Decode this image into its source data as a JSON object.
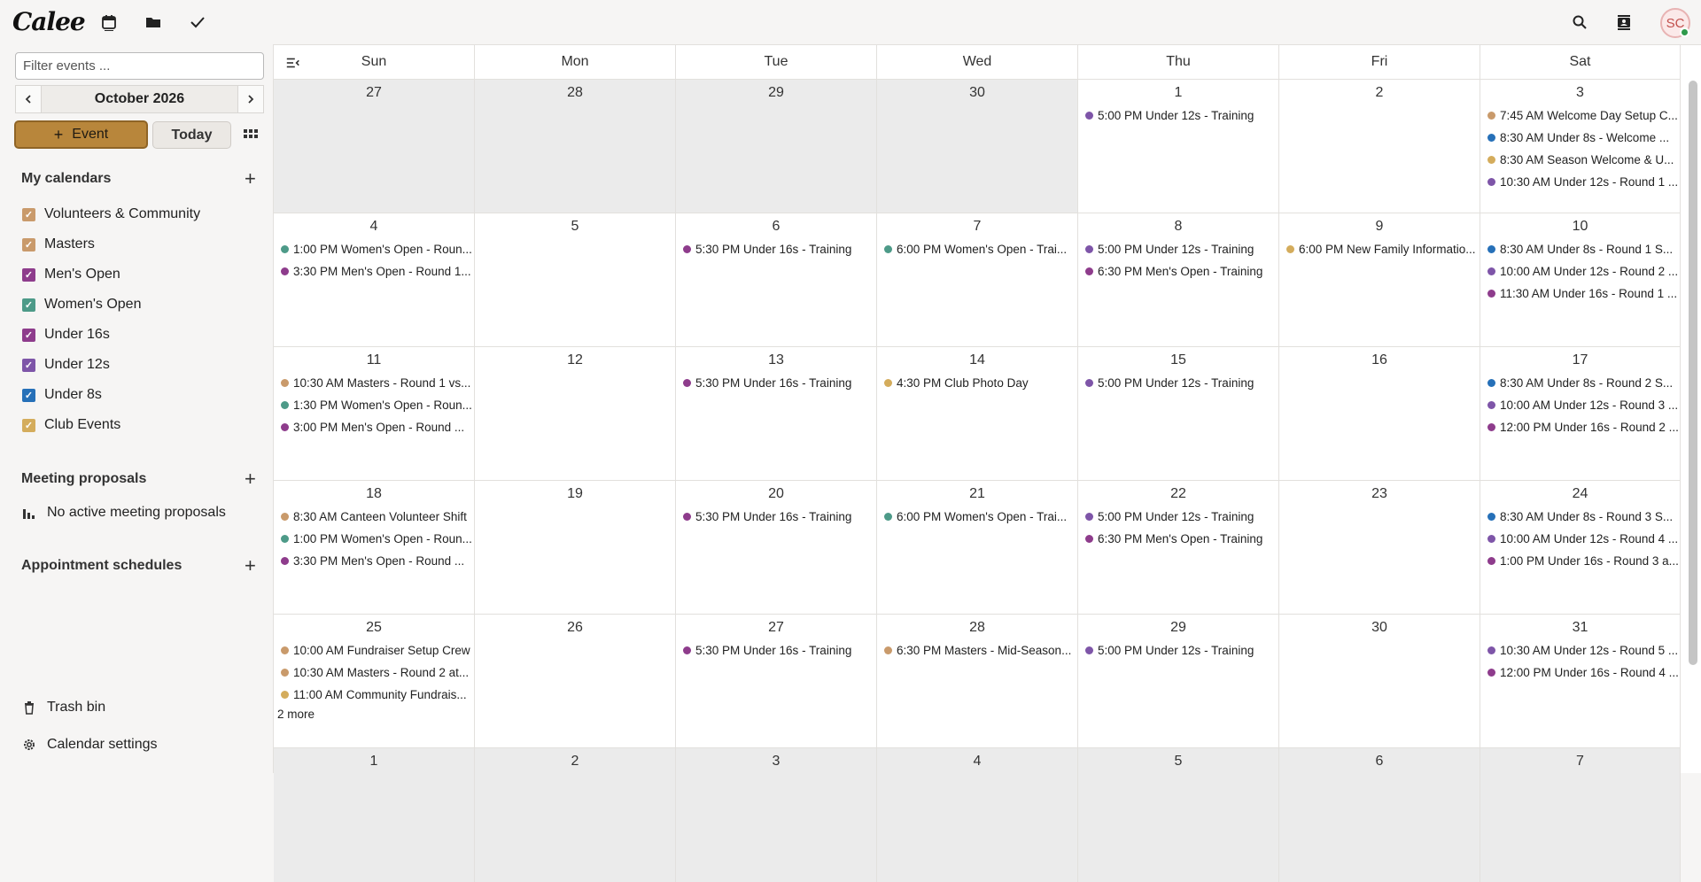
{
  "app": {
    "logo": "Calee"
  },
  "topbar": {
    "icons": [
      "calendar-icon",
      "folder-icon",
      "check-icon",
      "search-icon",
      "contacts-icon"
    ],
    "avatar_initials": "SC"
  },
  "sidebar": {
    "filter_placeholder": "Filter events ...",
    "month_label": "October 2026",
    "prev_label": "‹",
    "next_label": "›",
    "event_button": "Event",
    "today_button": "Today",
    "my_calendars_title": "My calendars",
    "calendars": [
      {
        "label": "Volunteers & Community",
        "color": "#c99a6b"
      },
      {
        "label": "Masters",
        "color": "#c99a6b"
      },
      {
        "label": "Men's Open",
        "color": "#8e3c8c"
      },
      {
        "label": "Women's Open",
        "color": "#4d9a88"
      },
      {
        "label": "Under 16s",
        "color": "#8e3c8c"
      },
      {
        "label": "Under 12s",
        "color": "#7e55a8"
      },
      {
        "label": "Under 8s",
        "color": "#2670b8"
      },
      {
        "label": "Club Events",
        "color": "#d4ac5c"
      }
    ],
    "meeting_title": "Meeting proposals",
    "meeting_empty": "No active meeting proposals",
    "appointment_title": "Appointment schedules",
    "trash_label": "Trash bin",
    "settings_label": "Calendar settings"
  },
  "calendar": {
    "weekdays": [
      "Sun",
      "Mon",
      "Tue",
      "Wed",
      "Thu",
      "Fri",
      "Sat"
    ],
    "colors": {
      "volunteer": "#c99a6b",
      "masters": "#c99a6b",
      "mens": "#8e3c8c",
      "womens": "#4d9a88",
      "u16": "#8e3c8c",
      "u12": "#7e55a8",
      "u8": "#2670b8",
      "club": "#d4ac5c"
    },
    "weeks": [
      [
        {
          "num": "27",
          "out": true,
          "events": []
        },
        {
          "num": "28",
          "out": true,
          "events": []
        },
        {
          "num": "29",
          "out": true,
          "events": []
        },
        {
          "num": "30",
          "out": true,
          "events": []
        },
        {
          "num": "1",
          "events": [
            {
              "text": "5:00 PM Under 12s - Training",
              "cal": "u12"
            }
          ]
        },
        {
          "num": "2",
          "events": []
        },
        {
          "num": "3",
          "events": [
            {
              "text": "7:45 AM Welcome Day Setup C...",
              "cal": "volunteer"
            },
            {
              "text": "8:30 AM Under 8s - Welcome ...",
              "cal": "u8"
            },
            {
              "text": "8:30 AM Season Welcome & U...",
              "cal": "club"
            },
            {
              "text": "10:30 AM Under 12s - Round 1 ...",
              "cal": "u12"
            }
          ]
        }
      ],
      [
        {
          "num": "4",
          "events": [
            {
              "text": "1:00 PM Women's Open - Roun...",
              "cal": "womens"
            },
            {
              "text": "3:30 PM Men's Open - Round 1...",
              "cal": "mens"
            }
          ]
        },
        {
          "num": "5",
          "events": []
        },
        {
          "num": "6",
          "events": [
            {
              "text": "5:30 PM Under 16s - Training",
              "cal": "u16"
            }
          ]
        },
        {
          "num": "7",
          "events": [
            {
              "text": "6:00 PM Women's Open - Trai...",
              "cal": "womens"
            }
          ]
        },
        {
          "num": "8",
          "events": [
            {
              "text": "5:00 PM Under 12s - Training",
              "cal": "u12"
            },
            {
              "text": "6:30 PM Men's Open - Training",
              "cal": "mens"
            }
          ]
        },
        {
          "num": "9",
          "events": [
            {
              "text": "6:00 PM New Family Informatio...",
              "cal": "club"
            }
          ]
        },
        {
          "num": "10",
          "events": [
            {
              "text": "8:30 AM Under 8s - Round 1 S...",
              "cal": "u8"
            },
            {
              "text": "10:00 AM Under 12s - Round 2 ...",
              "cal": "u12"
            },
            {
              "text": "11:30 AM Under 16s - Round 1 ...",
              "cal": "u16"
            }
          ]
        }
      ],
      [
        {
          "num": "11",
          "events": [
            {
              "text": "10:30 AM Masters - Round 1 vs...",
              "cal": "masters"
            },
            {
              "text": "1:30 PM Women's Open - Roun...",
              "cal": "womens"
            },
            {
              "text": "3:00 PM Men's Open - Round ...",
              "cal": "mens"
            }
          ]
        },
        {
          "num": "12",
          "events": []
        },
        {
          "num": "13",
          "events": [
            {
              "text": "5:30 PM Under 16s - Training",
              "cal": "u16"
            }
          ]
        },
        {
          "num": "14",
          "events": [
            {
              "text": "4:30 PM Club Photo Day",
              "cal": "club"
            }
          ]
        },
        {
          "num": "15",
          "events": [
            {
              "text": "5:00 PM Under 12s - Training",
              "cal": "u12"
            }
          ]
        },
        {
          "num": "16",
          "events": []
        },
        {
          "num": "17",
          "events": [
            {
              "text": "8:30 AM Under 8s - Round 2 S...",
              "cal": "u8"
            },
            {
              "text": "10:00 AM Under 12s - Round 3 ...",
              "cal": "u12"
            },
            {
              "text": "12:00 PM Under 16s - Round 2 ...",
              "cal": "u16"
            }
          ]
        }
      ],
      [
        {
          "num": "18",
          "events": [
            {
              "text": "8:30 AM Canteen Volunteer Shift",
              "cal": "volunteer"
            },
            {
              "text": "1:00 PM Women's Open - Roun...",
              "cal": "womens"
            },
            {
              "text": "3:30 PM Men's Open - Round ...",
              "cal": "mens"
            }
          ]
        },
        {
          "num": "19",
          "events": []
        },
        {
          "num": "20",
          "events": [
            {
              "text": "5:30 PM Under 16s - Training",
              "cal": "u16"
            }
          ]
        },
        {
          "num": "21",
          "events": [
            {
              "text": "6:00 PM Women's Open - Trai...",
              "cal": "womens"
            }
          ]
        },
        {
          "num": "22",
          "events": [
            {
              "text": "5:00 PM Under 12s - Training",
              "cal": "u12"
            },
            {
              "text": "6:30 PM Men's Open - Training",
              "cal": "mens"
            }
          ]
        },
        {
          "num": "23",
          "events": []
        },
        {
          "num": "24",
          "events": [
            {
              "text": "8:30 AM Under 8s - Round 3 S...",
              "cal": "u8"
            },
            {
              "text": "10:00 AM Under 12s - Round 4 ...",
              "cal": "u12"
            },
            {
              "text": "1:00 PM Under 16s - Round 3 a...",
              "cal": "u16"
            }
          ]
        }
      ],
      [
        {
          "num": "25",
          "more": "2 more",
          "events": [
            {
              "text": "10:00 AM Fundraiser Setup Crew",
              "cal": "volunteer"
            },
            {
              "text": "10:30 AM Masters - Round 2 at...",
              "cal": "masters"
            },
            {
              "text": "11:00 AM Community Fundrais...",
              "cal": "club"
            }
          ]
        },
        {
          "num": "26",
          "events": []
        },
        {
          "num": "27",
          "events": [
            {
              "text": "5:30 PM Under 16s - Training",
              "cal": "u16"
            }
          ]
        },
        {
          "num": "28",
          "events": [
            {
              "text": "6:30 PM Masters - Mid-Season...",
              "cal": "masters"
            }
          ]
        },
        {
          "num": "29",
          "events": [
            {
              "text": "5:00 PM Under 12s - Training",
              "cal": "u12"
            }
          ]
        },
        {
          "num": "30",
          "events": []
        },
        {
          "num": "31",
          "events": [
            {
              "text": "10:30 AM Under 12s - Round 5 ...",
              "cal": "u12"
            },
            {
              "text": "12:00 PM Under 16s - Round 4 ...",
              "cal": "u16"
            }
          ]
        }
      ],
      [
        {
          "num": "1",
          "out": true,
          "events": []
        },
        {
          "num": "2",
          "out": true,
          "events": []
        },
        {
          "num": "3",
          "out": true,
          "events": []
        },
        {
          "num": "4",
          "out": true,
          "events": []
        },
        {
          "num": "5",
          "out": true,
          "events": []
        },
        {
          "num": "6",
          "out": true,
          "events": []
        },
        {
          "num": "7",
          "out": true,
          "events": []
        }
      ]
    ]
  }
}
